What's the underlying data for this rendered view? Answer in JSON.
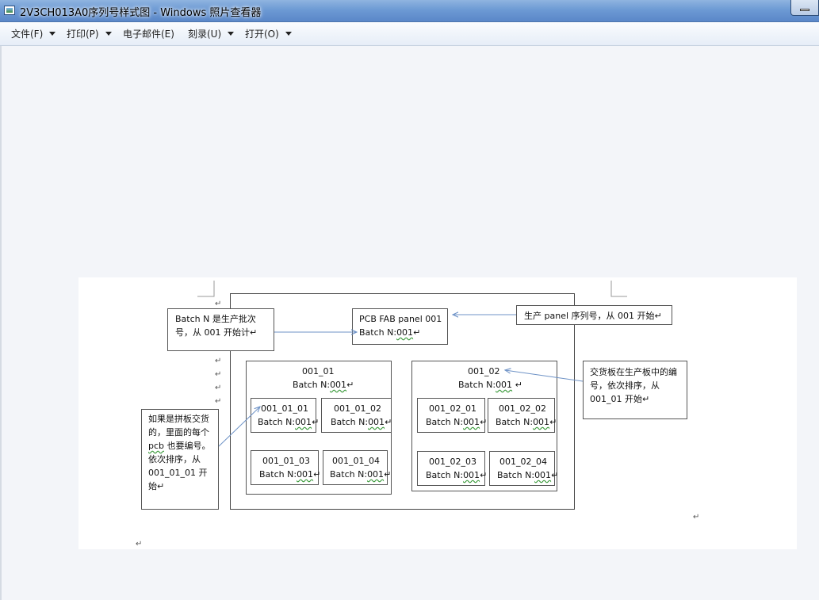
{
  "window": {
    "title": "2V3CH013A0序列号样式图 - Windows 照片查看器"
  },
  "menu": [
    {
      "label": "文件(F)",
      "has_dropdown": true
    },
    {
      "label": "打印(P)",
      "has_dropdown": true
    },
    {
      "label": "电子邮件(E)",
      "has_dropdown": false
    },
    {
      "label": "刻录(U)",
      "has_dropdown": true
    },
    {
      "label": "打开(O)",
      "has_dropdown": true
    }
  ],
  "diagram": {
    "paragraph_mark": "↵",
    "note_batch": "Batch N 是生产批次号，从 001 开始计",
    "panel_title": "PCB FAB panel 001",
    "panel_batch_label": "Batch N:",
    "panel_batch_value": "001",
    "note_panel": "生产 panel 序列号，从 001 开始",
    "note_delivery": "交货板在生产板中的编号，依次排序，从 001_01 开始",
    "note_pcb_a": "如果是拼板交货的，里面的每个",
    "note_pcb_word": "pcb",
    "note_pcb_b": "也要编号。依次排序，从 001_01_01 开始",
    "groups": [
      {
        "id": "001_01",
        "batch_label": "Batch N:",
        "batch_value": "001",
        "boards": [
          {
            "id": "001_01_01",
            "batch_label": "Batch N:",
            "batch_value": "001"
          },
          {
            "id": "001_01_02",
            "batch_label": "Batch N:",
            "batch_value": "001"
          },
          {
            "id": "001_01_03",
            "batch_label": "Batch N:",
            "batch_value": "001"
          },
          {
            "id": "001_01_04",
            "batch_label": "Batch N:",
            "batch_value": "001"
          }
        ]
      },
      {
        "id": "001_02",
        "batch_label": "Batch N:",
        "batch_value": "001",
        "boards": [
          {
            "id": "001_02_01",
            "batch_label": "Batch N:",
            "batch_value": "001"
          },
          {
            "id": "001_02_02",
            "batch_label": "Batch N:",
            "batch_value": "001"
          },
          {
            "id": "001_02_03",
            "batch_label": "Batch N:",
            "batch_value": "001"
          },
          {
            "id": "001_02_04",
            "batch_label": "Batch N:",
            "batch_value": "001"
          }
        ]
      }
    ]
  },
  "colors": {
    "arrow": "#6f93c7",
    "box_border": "#555555",
    "spell_underline": "#3a9a3a"
  }
}
